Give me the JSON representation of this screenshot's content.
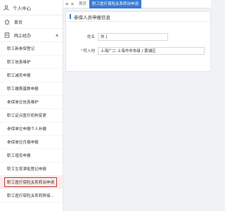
{
  "sidebar": {
    "user_label": "个人中心",
    "home_label": "首页",
    "group_label": "网上经办",
    "items": [
      {
        "label": "职工新参保登记"
      },
      {
        "label": "职工信息维护"
      },
      {
        "label": "职工减员申报"
      },
      {
        "label": "职工缴费基数申报"
      },
      {
        "label": "参保单位信息维护"
      },
      {
        "label": "职工定点医疗机构变更"
      },
      {
        "label": "参保单位申报个人补缴"
      },
      {
        "label": "参保单位月报申报"
      },
      {
        "label": "职工增员申报"
      },
      {
        "label": "职工生育津贴登记申报"
      },
      {
        "label": "职工医疗保险关系转出申请",
        "active": true
      },
      {
        "label": "职工医疗保险关系转移接..."
      }
    ]
  },
  "tabs": {
    "home": "首页",
    "active": "职工医疗保险关系转出申请"
  },
  "form": {
    "title": "参保人员申报信息",
    "name_label": "姓名",
    "name_value": "刘    ]",
    "dest_required": "*",
    "dest_label": "转入地",
    "dest_value": "上海广二   上海市市本级 / 黄浦区"
  },
  "colors": {
    "accent": "#3a7bd5",
    "active_border": "#c0392b"
  }
}
